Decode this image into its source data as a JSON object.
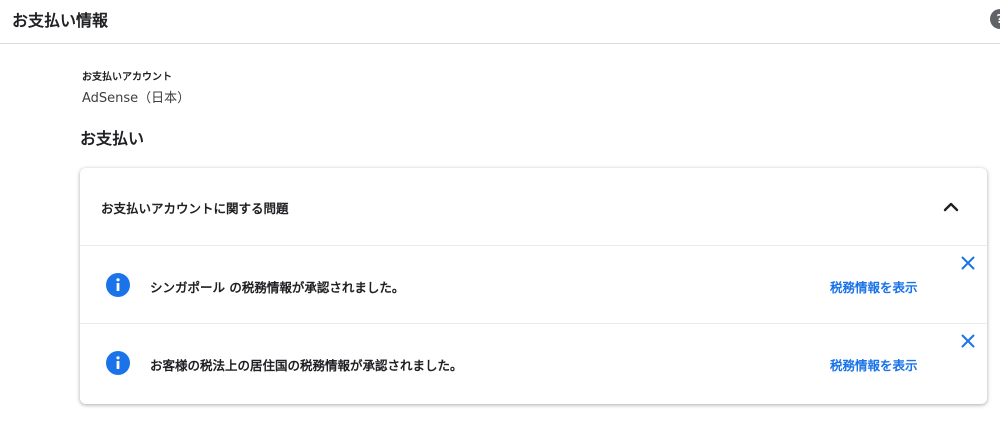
{
  "header": {
    "title": "お支払い情報",
    "help_icon": "help-circle-icon",
    "help_glyph": "?"
  },
  "account": {
    "label": "お支払いアカウント",
    "value": "AdSense（日本）"
  },
  "payments": {
    "section_title": "お支払い",
    "issues_card": {
      "title": "お支払いアカウントに関する問題",
      "expanded": true,
      "items": [
        {
          "icon": "info-icon",
          "message": "シンガポール の税務情報が承認されました。",
          "action_label": "税務情報を表示"
        },
        {
          "icon": "info-icon",
          "message": "お客様の税法上の居住国の税務情報が承認されました。",
          "action_label": "税務情報を表示"
        }
      ]
    }
  },
  "colors": {
    "accent": "#1a73e8",
    "info_icon": "#1a73e8",
    "text": "#202124",
    "divider": "#dadce0"
  }
}
